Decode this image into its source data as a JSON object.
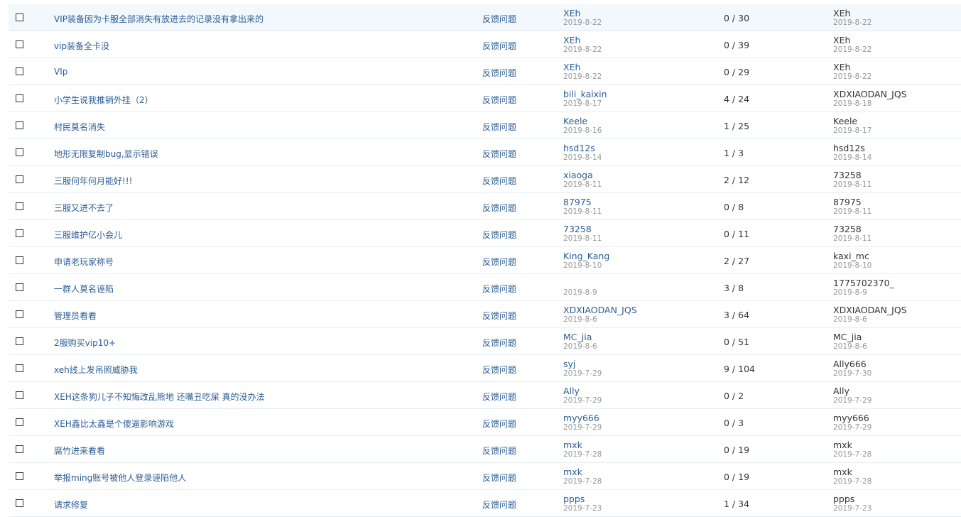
{
  "threads": [
    {
      "title": "VIP装备因为卡服全部消失有放进去的记录没有拿出来的",
      "category": "反馈问题",
      "author": "XEh",
      "author_date": "2019-8-22",
      "stats": "0 / 30",
      "last_poster": "XEh",
      "last_date": "2019-8-22"
    },
    {
      "title": "vip装备全卡没",
      "category": "反馈问题",
      "author": "XEh",
      "author_date": "2019-8-22",
      "stats": "0 / 39",
      "last_poster": "XEh",
      "last_date": "2019-8-22"
    },
    {
      "title": "VIp",
      "category": "反馈问题",
      "author": "XEh",
      "author_date": "2019-8-22",
      "stats": "0 / 29",
      "last_poster": "XEh",
      "last_date": "2019-8-22"
    },
    {
      "title": "小学生说我推销外挂（2）",
      "category": "反馈问题",
      "author": "bili_kaixin",
      "author_date": "2019-8-17",
      "stats": "4 / 24",
      "last_poster": "XDXIAODAN_JQS",
      "last_date": "2019-8-18"
    },
    {
      "title": "村民莫名消失",
      "category": "反馈问题",
      "author": "Keele",
      "author_date": "2019-8-16",
      "stats": "1 / 25",
      "last_poster": "Keele",
      "last_date": "2019-8-17"
    },
    {
      "title": "地形无限复制bug,显示错误",
      "category": "反馈问题",
      "author": "hsd12s",
      "author_date": "2019-8-14",
      "stats": "1 / 3",
      "last_poster": "hsd12s",
      "last_date": "2019-8-14"
    },
    {
      "title": "三服何年何月能好!!!",
      "category": "反馈问题",
      "author": "xiaoga",
      "author_date": "2019-8-11",
      "stats": "2 / 12",
      "last_poster": "73258",
      "last_date": "2019-8-11"
    },
    {
      "title": "三服又进不去了",
      "category": "反馈问题",
      "author": "87975",
      "author_date": "2019-8-11",
      "stats": "0 / 8",
      "last_poster": "87975",
      "last_date": "2019-8-11"
    },
    {
      "title": "三服维护亿小会儿",
      "category": "反馈问题",
      "author": "73258",
      "author_date": "2019-8-11",
      "stats": "0 / 11",
      "last_poster": "73258",
      "last_date": "2019-8-11"
    },
    {
      "title": "申请老玩家称号",
      "category": "反馈问题",
      "author": "King_Kang",
      "author_date": "2019-8-10",
      "stats": "2 / 27",
      "last_poster": "kaxi_mc",
      "last_date": "2019-8-10"
    },
    {
      "title": "一群人莫名诬陷",
      "category": "反馈问题",
      "author": "",
      "author_date": "2019-8-9",
      "stats": "3 / 8",
      "last_poster": "1775702370_",
      "last_date": "2019-8-9"
    },
    {
      "title": "管理员看看",
      "category": "反馈问题",
      "author": "XDXIAODAN_JQS",
      "author_date": "2019-8-6",
      "stats": "3 / 64",
      "last_poster": "XDXIAODAN_JQS",
      "last_date": "2019-8-6"
    },
    {
      "title": "2服购买vip10+",
      "category": "反馈问题",
      "author": "MC_jia",
      "author_date": "2019-8-6",
      "stats": "0 / 51",
      "last_poster": "MC_jia",
      "last_date": "2019-8-6"
    },
    {
      "title": "xeh线上发吊照威胁我",
      "category": "反馈问题",
      "author": "syj",
      "author_date": "2019-7-29",
      "stats": "9 / 104",
      "last_poster": "Ally666",
      "last_date": "2019-7-30"
    },
    {
      "title": "XEH这条狗儿子不知悔改乱熊地 还嘴丑吃屎 真的没办法",
      "category": "反馈问题",
      "author": "Ally",
      "author_date": "2019-7-29",
      "stats": "0 / 2",
      "last_poster": "Ally",
      "last_date": "2019-7-29"
    },
    {
      "title": "XEH鑫比太鑫是个傻逼影响游戏",
      "category": "反馈问题",
      "author": "myy666",
      "author_date": "2019-7-29",
      "stats": "0 / 3",
      "last_poster": "myy666",
      "last_date": "2019-7-29"
    },
    {
      "title": "腐竹进来看看",
      "category": "反馈问题",
      "author": "mxk",
      "author_date": "2019-7-28",
      "stats": "0 / 19",
      "last_poster": "mxk",
      "last_date": "2019-7-28"
    },
    {
      "title": "举报ming账号被他人登录诬陷他人",
      "category": "反馈问题",
      "author": "mxk",
      "author_date": "2019-7-28",
      "stats": "0 / 19",
      "last_poster": "mxk",
      "last_date": "2019-7-28"
    },
    {
      "title": "请求修复",
      "category": "反馈问题",
      "author": "ppps",
      "author_date": "2019-7-23",
      "stats": "1 / 34",
      "last_poster": "ppps",
      "last_date": "2019-7-23"
    }
  ]
}
